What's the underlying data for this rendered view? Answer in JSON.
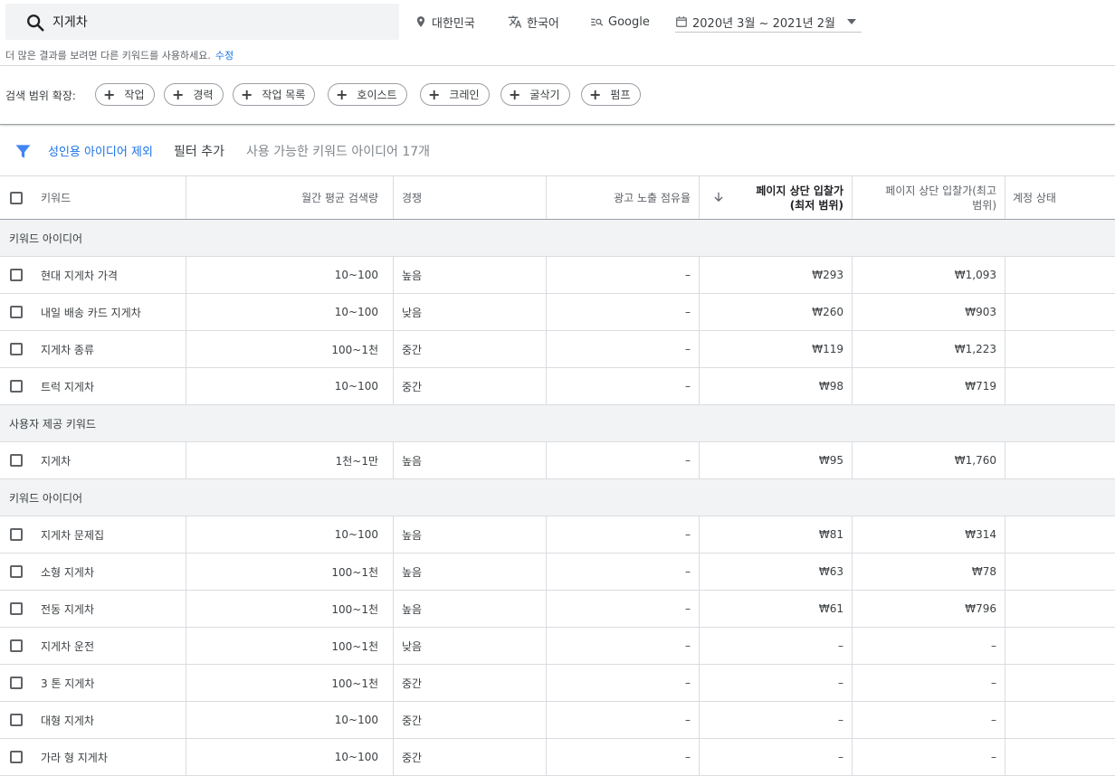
{
  "search": {
    "value": "지게차"
  },
  "options": {
    "location": "대한민국",
    "language": "한국어",
    "network": "Google",
    "date_range": "2020년 3월 ~ 2021년 2월"
  },
  "hint": {
    "text": "더 많은 결과를 보려면 다른 키워드를 사용하세요.",
    "link": "수정"
  },
  "expand": {
    "label": "검색 범위 확장:",
    "chips": [
      "작업",
      "경력",
      "작업 목록",
      "호이스트",
      "크레인",
      "굴삭기",
      "펌프"
    ]
  },
  "filter": {
    "active_chip": "성인용 아이디어 제외",
    "add_filter": "필터 추가",
    "idea_count": "사용 가능한 키워드 아이디어 17개"
  },
  "columns": {
    "keyword": "키워드",
    "volume": "월간 평균 검색량",
    "competition": "경쟁",
    "impression_share": "광고 노출 점유율",
    "bid_low_line1": "페이지 상단 입찰가",
    "bid_low_line2": "(최저 범위)",
    "bid_high_line1": "페이지 상단 입찰가(최고",
    "bid_high_line2": "범위)",
    "account_status": "계정 상태"
  },
  "sections": [
    {
      "title": "키워드 아이디어",
      "rows": [
        {
          "keyword": "현대 지게차 가격",
          "volume": "10~100",
          "competition": "높음",
          "impression": "–",
          "low": "₩293",
          "high": "₩1,093"
        },
        {
          "keyword": "내일 배송 카드 지게차",
          "volume": "10~100",
          "competition": "낮음",
          "impression": "–",
          "low": "₩260",
          "high": "₩903"
        },
        {
          "keyword": "지게차 종류",
          "volume": "100~1천",
          "competition": "중간",
          "impression": "–",
          "low": "₩119",
          "high": "₩1,223"
        },
        {
          "keyword": "트럭 지게차",
          "volume": "10~100",
          "competition": "중간",
          "impression": "–",
          "low": "₩98",
          "high": "₩719"
        }
      ]
    },
    {
      "title": "사용자 제공 키워드",
      "rows": [
        {
          "keyword": "지게차",
          "volume": "1천~1만",
          "competition": "높음",
          "impression": "–",
          "low": "₩95",
          "high": "₩1,760"
        }
      ]
    },
    {
      "title": "키워드 아이디어",
      "rows": [
        {
          "keyword": "지게차 문제집",
          "volume": "10~100",
          "competition": "높음",
          "impression": "–",
          "low": "₩81",
          "high": "₩314"
        },
        {
          "keyword": "소형 지게차",
          "volume": "100~1천",
          "competition": "높음",
          "impression": "–",
          "low": "₩63",
          "high": "₩78"
        },
        {
          "keyword": "전동 지게차",
          "volume": "100~1천",
          "competition": "높음",
          "impression": "–",
          "low": "₩61",
          "high": "₩796"
        },
        {
          "keyword": "지게차 운전",
          "volume": "100~1천",
          "competition": "낮음",
          "impression": "–",
          "low": "–",
          "high": "–"
        },
        {
          "keyword": "3 톤 지게차",
          "volume": "100~1천",
          "competition": "중간",
          "impression": "–",
          "low": "–",
          "high": "–"
        },
        {
          "keyword": "대형 지게차",
          "volume": "10~100",
          "competition": "중간",
          "impression": "–",
          "low": "–",
          "high": "–"
        },
        {
          "keyword": "가라 형 지게차",
          "volume": "10~100",
          "competition": "중간",
          "impression": "–",
          "low": "–",
          "high": "–"
        }
      ]
    }
  ]
}
